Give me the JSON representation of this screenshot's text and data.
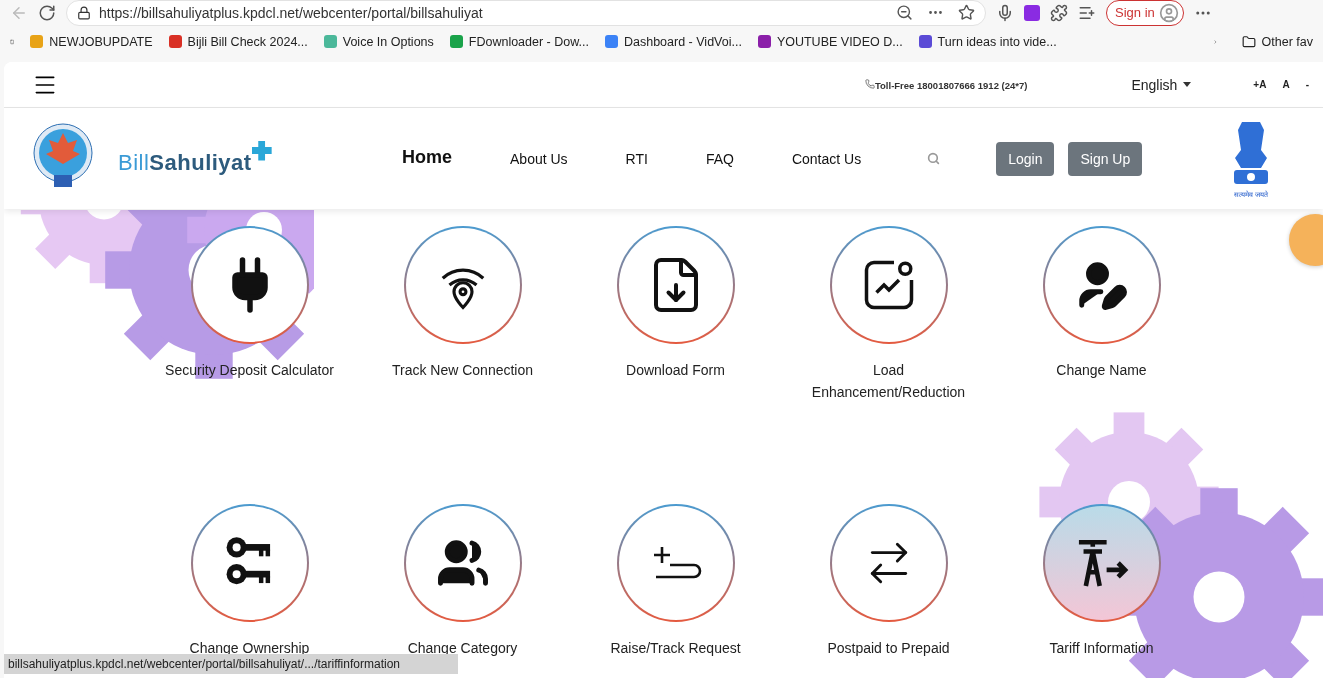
{
  "browser": {
    "url": "https://billsahuliyatplus.kpdcl.net/webcenter/portal/billsahuliyat",
    "sign_in": "Sign in",
    "bookmarks": [
      {
        "label": "NEWJOBUPDATE",
        "color": "#e8a317"
      },
      {
        "label": "Bijli Bill Check 2024...",
        "color": "#d93025"
      },
      {
        "label": "Voice In Options",
        "color": "#4bb89a"
      },
      {
        "label": "FDownloader - Dow...",
        "color": "#1aa34a"
      },
      {
        "label": "Dashboard - VidVoi...",
        "color": "#3b82f6"
      },
      {
        "label": "YOUTUBE VIDEO D...",
        "color": "#8b1fa9"
      },
      {
        "label": "Turn ideas into vide...",
        "color": "#5b4bd6"
      }
    ],
    "other_bookmarks": "Other fav"
  },
  "topbar": {
    "toll_free": "Toll-Free 18001807666 1912 (24*7)",
    "language": "English",
    "font_sizes": [
      "+A",
      "A",
      "-"
    ]
  },
  "header": {
    "logo": {
      "name_light": "Bill",
      "name_bold": "Sahuliyat"
    },
    "nav": [
      {
        "label": "Home",
        "selected": true
      },
      {
        "label": "About Us",
        "selected": false
      },
      {
        "label": "RTI",
        "selected": false
      },
      {
        "label": "FAQ",
        "selected": false
      },
      {
        "label": "Contact Us",
        "selected": false
      }
    ],
    "buttons": [
      "Login",
      "Sign Up"
    ],
    "emblem_caption": "सत्यमेव जयते"
  },
  "services": [
    {
      "label": "Security Deposit Calculator",
      "hovered": false
    },
    {
      "label": "Track New Connection",
      "hovered": false
    },
    {
      "label": "Download Form",
      "hovered": false
    },
    {
      "label": "Load Enhancement/Reduction",
      "hovered": false
    },
    {
      "label": "Change Name",
      "hovered": false
    },
    {
      "label": "Change Ownership",
      "hovered": false
    },
    {
      "label": "Change Category",
      "hovered": false
    },
    {
      "label": "Raise/Track Request",
      "hovered": false
    },
    {
      "label": "Postpaid to Prepaid",
      "hovered": false
    },
    {
      "label": "Tariff Information",
      "hovered": true
    }
  ],
  "status_bar": "billsahuliyatplus.kpdcl.net/webcenter/portal/billsahuliyat/.../tariffinformation"
}
